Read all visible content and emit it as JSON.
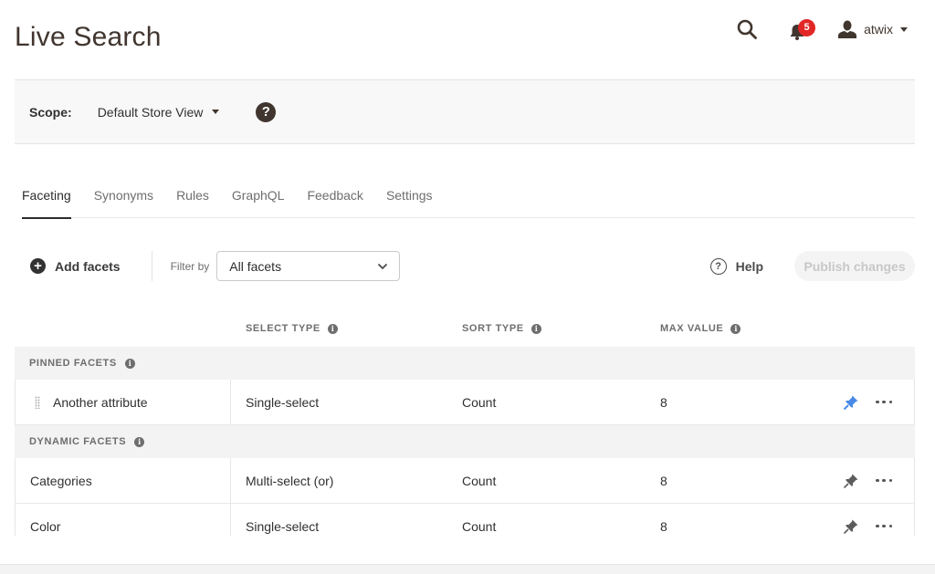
{
  "page": {
    "title": "Live Search"
  },
  "header": {
    "notifications_count": "5",
    "user_name": "atwix",
    "icons": {
      "search": "search-icon",
      "bell": "bell-icon",
      "user": "user-icon"
    }
  },
  "scope": {
    "label": "Scope:",
    "value": "Default Store View",
    "help_glyph": "?"
  },
  "tabs": [
    {
      "label": "Faceting",
      "active": true
    },
    {
      "label": "Synonyms",
      "active": false
    },
    {
      "label": "Rules",
      "active": false
    },
    {
      "label": "GraphQL",
      "active": false
    },
    {
      "label": "Feedback",
      "active": false
    },
    {
      "label": "Settings",
      "active": false
    }
  ],
  "toolbar": {
    "add_facets_label": "Add facets",
    "filter_label": "Filter by",
    "filter_value": "All facets",
    "help_label": "Help",
    "publish_label": "Publish changes"
  },
  "table": {
    "columns": {
      "select_type": "SELECT TYPE",
      "sort_type": "SORT TYPE",
      "max_value": "MAX VALUE"
    },
    "groups": [
      {
        "label": "PINNED FACETS",
        "rows": [
          {
            "name": "Another attribute",
            "select_type": "Single-select",
            "sort_type": "Count",
            "max_value": "8",
            "pinned": true
          }
        ]
      },
      {
        "label": "DYNAMIC FACETS",
        "rows": [
          {
            "name": "Categories",
            "select_type": "Multi-select (or)",
            "sort_type": "Count",
            "max_value": "8",
            "pinned": false
          },
          {
            "name": "Color",
            "select_type": "Single-select",
            "sort_type": "Count",
            "max_value": "8",
            "pinned": false
          }
        ]
      }
    ]
  },
  "colors": {
    "pin_active": "#4a8ae6",
    "pin_inactive": "#5c5c5c",
    "badge": "#e22626",
    "title": "#41362f"
  }
}
